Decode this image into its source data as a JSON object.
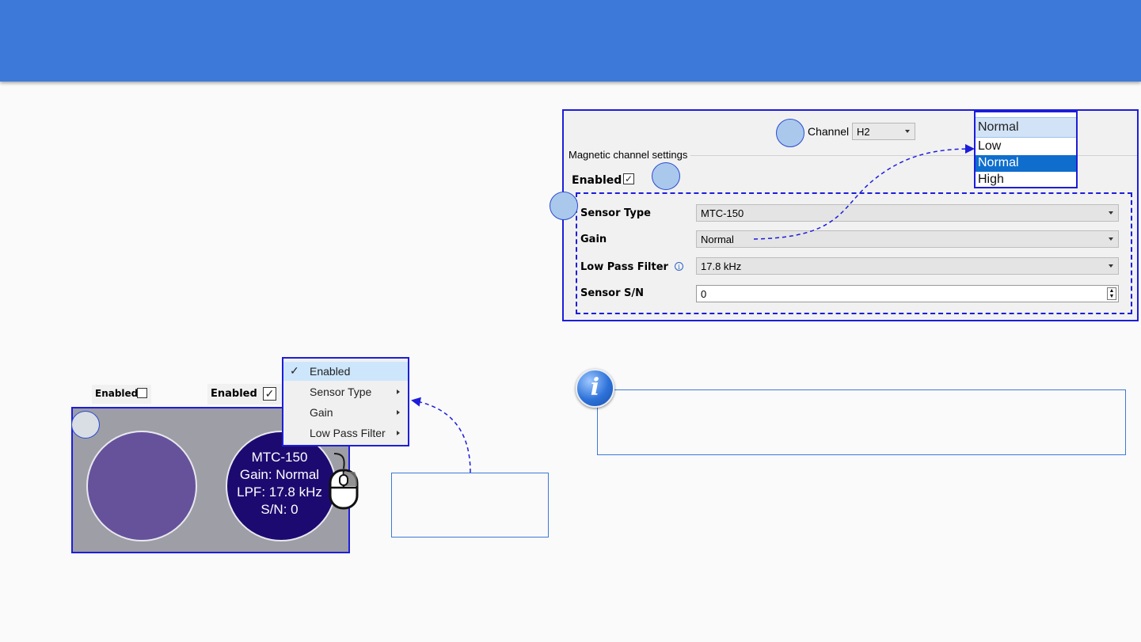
{
  "settings_panel": {
    "channel_label": "Channel",
    "channel_value": "H2",
    "group_title": "Magnetic channel settings",
    "enabled_label": "Enabled",
    "enabled_checked": true,
    "fields": {
      "sensor_type": {
        "label": "Sensor Type",
        "value": "MTC-150"
      },
      "gain": {
        "label": "Gain",
        "value": "Normal"
      },
      "low_pass_filter": {
        "label": "Low Pass Filter",
        "value": "17.8 kHz"
      },
      "sensor_sn": {
        "label": "Sensor S/N",
        "value": "0"
      }
    },
    "info_icon": "info-icon"
  },
  "gain_dropdown": {
    "current": "Normal",
    "options": [
      "Low",
      "Normal",
      "High"
    ],
    "selected": "Normal"
  },
  "channel_view": {
    "left_enabled_label": "Enabled",
    "left_enabled_checked": false,
    "right_enabled_label": "Enabled",
    "right_enabled_checked": true,
    "sensor_lines": [
      "MTC-150",
      "Gain: Normal",
      "LPF: 17.8 kHz",
      "S/N: 0"
    ],
    "colors": {
      "disabled_circle": "#66529b",
      "enabled_circle": "#1d0a70",
      "panel_bg": "#9e9ea6"
    }
  },
  "context_menu": {
    "items": [
      {
        "label": "Enabled",
        "checked": true,
        "submenu": false
      },
      {
        "label": "Sensor Type",
        "checked": false,
        "submenu": true
      },
      {
        "label": "Gain",
        "checked": false,
        "submenu": true
      },
      {
        "label": "Low Pass Filter",
        "checked": false,
        "submenu": true
      }
    ]
  },
  "icons": {
    "mouse": "mouse-icon",
    "note": "info-icon",
    "check": "checkmark-icon"
  },
  "theme": {
    "header": "#3c79d9",
    "outline": "#1d1ddb",
    "accent_circle": "#aac8ec"
  }
}
